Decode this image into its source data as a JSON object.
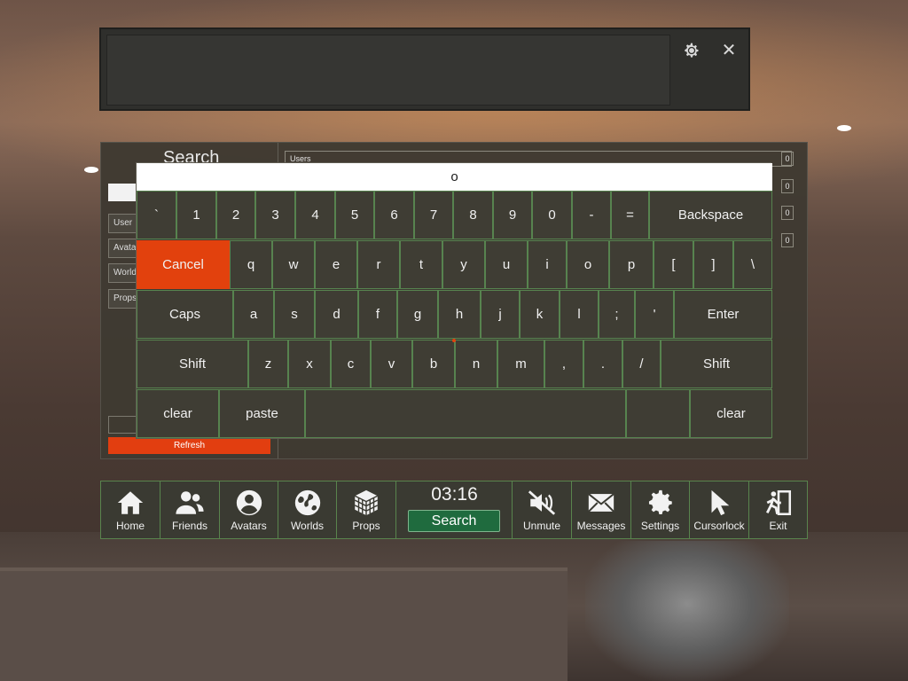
{
  "top_panel": {
    "settings_icon": "gear-icon",
    "close_icon": "close-icon"
  },
  "menu": {
    "title": "Search",
    "filters": [
      "User",
      "Avata",
      "World",
      "Props"
    ],
    "refresh_label": "Refresh",
    "results": [
      {
        "label": "Users",
        "count": "0"
      },
      {
        "label": "",
        "count": "0"
      },
      {
        "label": "",
        "count": "0"
      },
      {
        "label": "",
        "count": "0"
      }
    ]
  },
  "keyboard": {
    "input_value": "o",
    "row1": [
      "`",
      "1",
      "2",
      "3",
      "4",
      "5",
      "6",
      "7",
      "8",
      "9",
      "0",
      "-",
      "=",
      "Backspace"
    ],
    "row2": [
      "Cancel",
      "q",
      "w",
      "e",
      "r",
      "t",
      "y",
      "u",
      "i",
      "o",
      "p",
      "[",
      "]",
      "\\"
    ],
    "row3": [
      "Caps",
      "a",
      "s",
      "d",
      "f",
      "g",
      "h",
      "j",
      "k",
      "l",
      ";",
      "'",
      "Enter"
    ],
    "row4": [
      "Shift",
      "z",
      "x",
      "c",
      "v",
      "b",
      "n",
      "m",
      ",",
      ".",
      "/",
      "Shift"
    ],
    "row5": [
      "clear",
      "paste",
      "",
      "",
      "clear"
    ]
  },
  "dock": {
    "items": [
      {
        "label": "Home",
        "icon": "home-icon"
      },
      {
        "label": "Friends",
        "icon": "friends-icon"
      },
      {
        "label": "Avatars",
        "icon": "avatar-icon"
      },
      {
        "label": "Worlds",
        "icon": "globe-icon"
      },
      {
        "label": "Props",
        "icon": "cube-icon"
      },
      {
        "label": "Unmute",
        "icon": "speaker-muted-icon"
      },
      {
        "label": "Messages",
        "icon": "envelope-icon"
      },
      {
        "label": "Settings",
        "icon": "gear-icon"
      },
      {
        "label": "Cursorlock",
        "icon": "cursor-icon"
      },
      {
        "label": "Exit",
        "icon": "exit-icon"
      }
    ],
    "clock": "03:16",
    "search_label": "Search"
  },
  "colors": {
    "accent": "#e2410d",
    "outline_green": "#59844d",
    "panel": "#3c3a32",
    "search_green": "#1f6b3e"
  }
}
